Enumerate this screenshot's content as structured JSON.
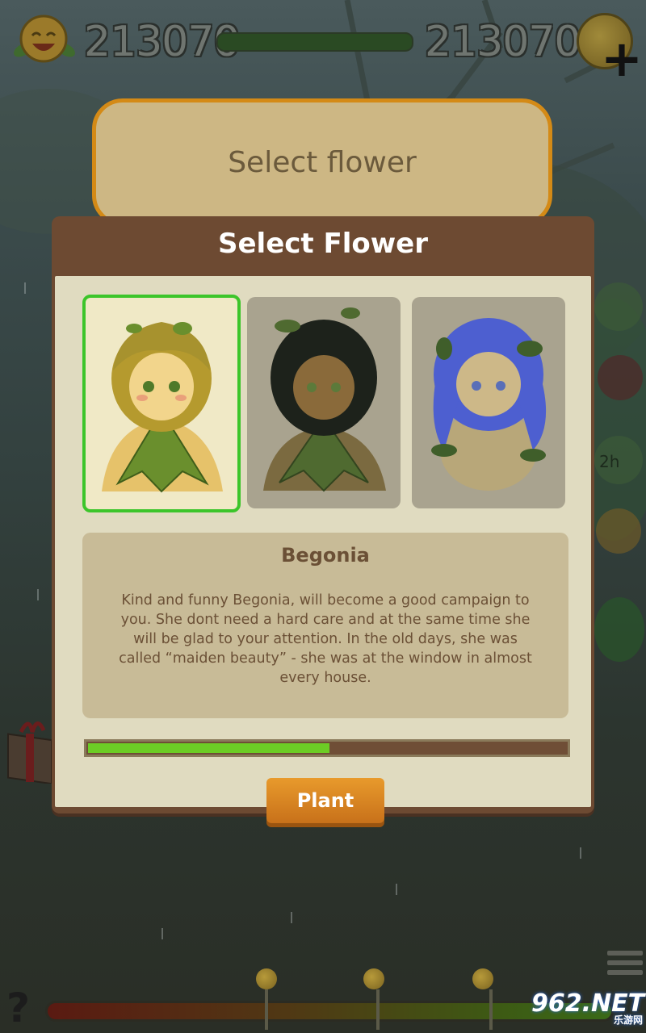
{
  "hud": {
    "score_left": "213070",
    "score_right": "213070"
  },
  "header": {
    "text": "Select flower"
  },
  "dialog": {
    "title": "Select Flower",
    "flowers": [
      {
        "name": "begonia",
        "hair_color": "#a7922e",
        "selected": true
      },
      {
        "name": "dark-flower",
        "hair_color": "#1d221b",
        "selected": false
      },
      {
        "name": "blue-flower",
        "hair_color": "#4d5fd0",
        "selected": false
      }
    ],
    "description": {
      "name": "Begonia",
      "text": "Kind and funny Begonia, will become a good campaign to you. She dont need a hard care and at the same time she will be glad to your attention. In the old days, she was called “maiden beauty” - she was at the window in almost every house."
    },
    "progress": 0.505,
    "plant_label": "Plant"
  },
  "side": {
    "timer_label": "2h"
  },
  "bottom": {
    "help": "?"
  },
  "watermark": {
    "main": "962.NET",
    "sub": "乐游网"
  },
  "colors": {
    "accent_green": "#3cc52a",
    "dialog_brown": "#6d4a32",
    "button_orange": "#e89a2c"
  }
}
